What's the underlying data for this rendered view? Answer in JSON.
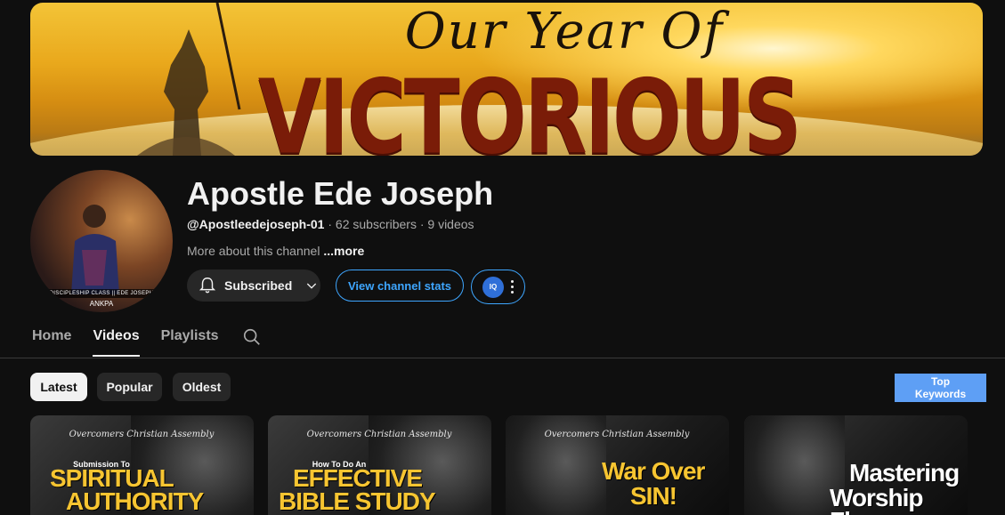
{
  "banner": {
    "line1": "Our Year Of",
    "line2": "VICTORIOUS LIVING"
  },
  "avatar": {
    "caption": "DISCIPLESHIP CLASS || EDE JOSEPH",
    "caption2": "ANKPA"
  },
  "channel": {
    "name": "Apostle Ede Joseph",
    "handle": "@Apostleedejoseph-01",
    "stats": " · 62 subscribers · 9 videos",
    "about": "More about this channel ",
    "more": "...more"
  },
  "buttons": {
    "subscribed": "Subscribed",
    "stats": "View channel stats",
    "ext_icon": "IQ"
  },
  "tabs": [
    "Home",
    "Videos",
    "Playlists"
  ],
  "active_tab": "Videos",
  "chips": [
    "Latest",
    "Popular",
    "Oldest"
  ],
  "active_chip": "Latest",
  "top_keywords": {
    "line1": "Top",
    "line2": "Keywords"
  },
  "thumbnails": [
    {
      "small": "Overcomers Christian Assembly",
      "sub": "Submission To",
      "big1": "SPIRITUAL",
      "big2": "AUTHORITY"
    },
    {
      "small": "Overcomers Christian Assembly",
      "sub": "How To Do An",
      "big1": "EFFECTIVE",
      "big2": "BIBLE STUDY"
    },
    {
      "small": "Overcomers Christian Assembly",
      "big1": "War Over",
      "big2": "SIN!"
    },
    {
      "big1": "Mastering",
      "big2": "Worship Flow"
    }
  ],
  "colors": {
    "background": "#0f0f0f",
    "accent_blue": "#3ea6ff",
    "chip_bg": "#272727",
    "keyword_btn": "#5e9ff5",
    "thumb_yellow": "#f7c531"
  }
}
